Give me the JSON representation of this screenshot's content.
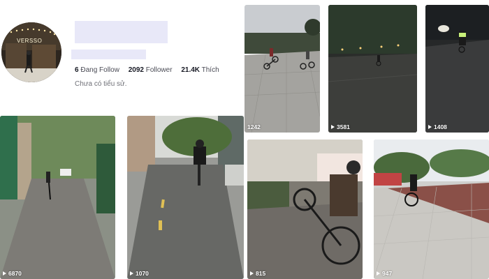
{
  "profile": {
    "avatar_sign_text": "VERSSO",
    "stats": [
      {
        "value": "6",
        "label": "Đang Follow"
      },
      {
        "value": "2092",
        "label": "Follower"
      },
      {
        "value": "21.4K",
        "label": "Thích"
      }
    ],
    "bio": "Chưa có tiểu sử."
  },
  "videos": [
    {
      "views": "1242"
    },
    {
      "views": "3581"
    },
    {
      "views": "1408"
    },
    {
      "views": "6870"
    },
    {
      "views": "1070"
    },
    {
      "views": "815"
    },
    {
      "views": "947"
    }
  ],
  "colors": {
    "text_primary": "#161823",
    "text_secondary": "#6f7077",
    "redaction": "#e8e8f8"
  }
}
